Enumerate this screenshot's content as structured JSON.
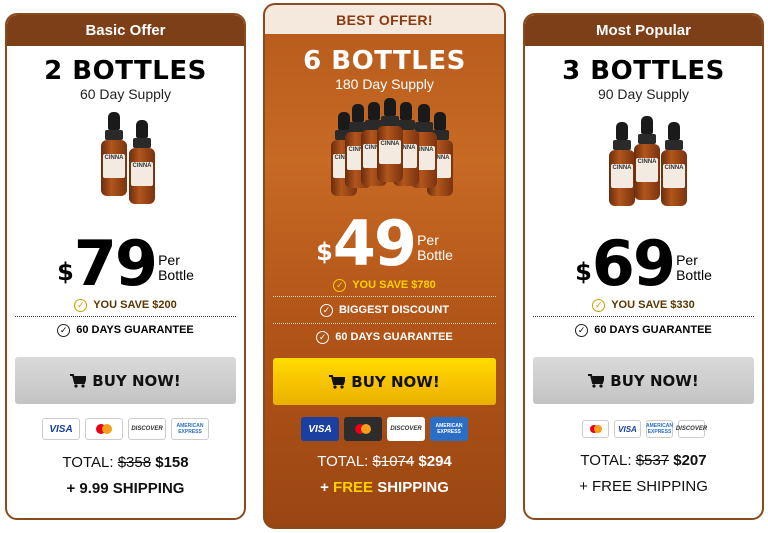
{
  "offers": [
    {
      "header": "Basic Offer",
      "title": "2 BOTTLES",
      "supply": "60 Day Supply",
      "currency": "$",
      "price": "79",
      "per_line1": "Per",
      "per_line2": "Bottle",
      "savings": "YOU SAVE $200",
      "features": [
        "60 DAYS GUARANTEE"
      ],
      "button_label": "BUY NOW!",
      "total_label": "TOTAL:",
      "old_total": "$358",
      "new_total": "$158",
      "shipping": "+ 9.99 SHIPPING",
      "payment_cards": [
        "VISA",
        "mastercard",
        "DISCOVER",
        "AMERICAN EXPRESS"
      ],
      "bottle_label": "CINNA"
    },
    {
      "header": "BEST OFFER!",
      "title": "6 BOTTLES",
      "supply": "180 Day Supply",
      "currency": "$",
      "price": "49",
      "per_line1": "Per",
      "per_line2": "Bottle",
      "savings": "YOU SAVE $780",
      "features": [
        "BIGGEST DISCOUNT",
        "60 DAYS GUARANTEE"
      ],
      "button_label": "BUY NOW!",
      "total_label": "TOTAL:",
      "old_total": "$1074",
      "new_total": "$294",
      "shipping_prefix": "+",
      "shipping_free": "FREE",
      "shipping_suffix": "SHIPPING",
      "payment_cards": [
        "VISA",
        "mastercard",
        "DISCOVER",
        "AMERICAN EXPRESS"
      ],
      "bottle_label": "CINNA"
    },
    {
      "header": "Most Popular",
      "title": "3 BOTTLES",
      "supply": "90 Day Supply",
      "currency": "$",
      "price": "69",
      "per_line1": "Per",
      "per_line2": "Bottle",
      "savings": "YOU SAVE $330",
      "features": [
        "60 DAYS GUARANTEE"
      ],
      "button_label": "BUY NOW!",
      "total_label": "TOTAL:",
      "old_total": "$537",
      "new_total": "$207",
      "shipping": "+ FREE SHIPPING",
      "payment_cards": [
        "mastercard",
        "VISA",
        "AMERICAN EXPRESS",
        "DISCOVER"
      ],
      "bottle_label": "CINNA"
    }
  ],
  "colors": {
    "brand_brown": "#7d3f17",
    "best_gradient": "#b65a1c",
    "buy_highlight": "#ffd100",
    "buy_default": "#cfcfcf"
  },
  "icons": [
    "check-circle-icon",
    "shopping-cart-icon"
  ]
}
